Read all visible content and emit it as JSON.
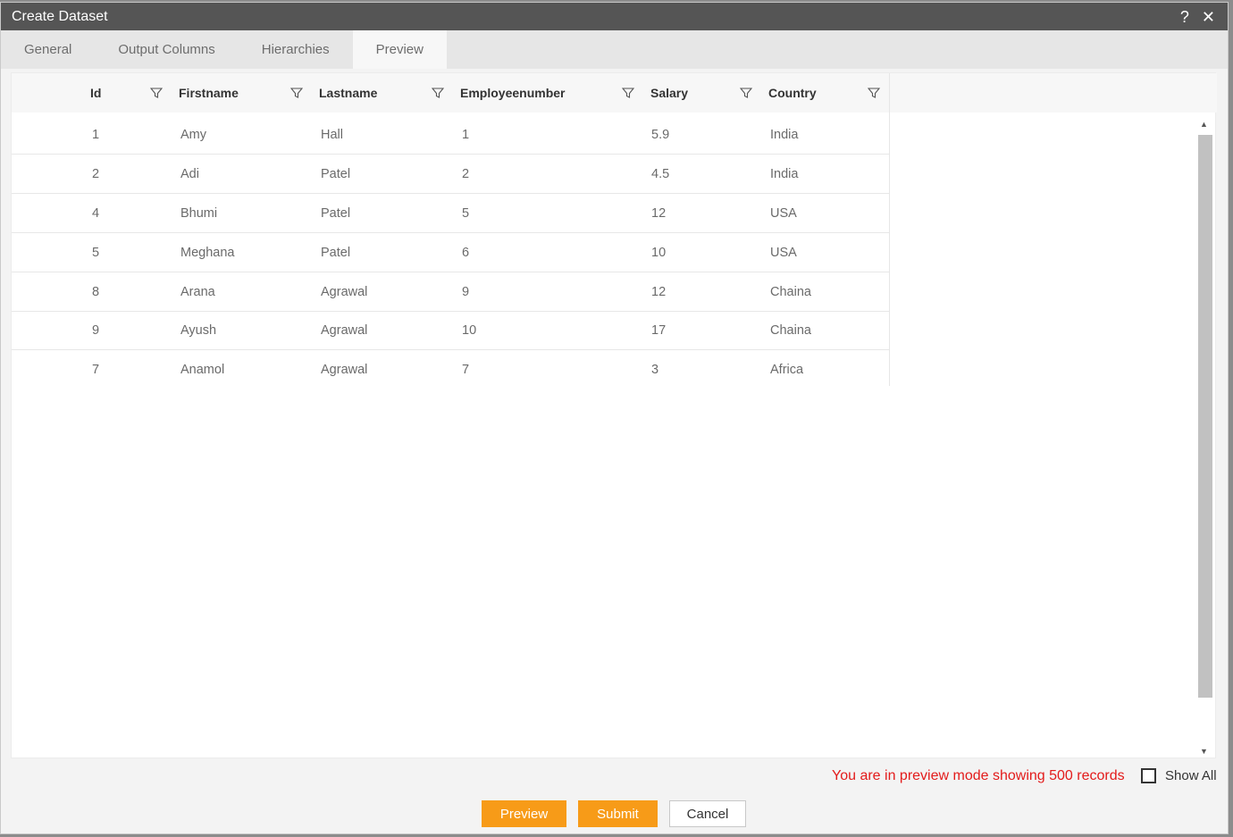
{
  "dialog": {
    "title": "Create Dataset",
    "help_icon": "?",
    "close_icon": "✕"
  },
  "tabs": [
    {
      "label": "General"
    },
    {
      "label": "Output Columns"
    },
    {
      "label": "Hierarchies"
    },
    {
      "label": "Preview",
      "active": true
    }
  ],
  "grid": {
    "columns": [
      "Id",
      "Firstname",
      "Lastname",
      "Employeenumber",
      "Salary",
      "Country"
    ],
    "rows": [
      [
        "1",
        "Amy",
        "Hall",
        "1",
        "5.9",
        "India"
      ],
      [
        "2",
        "Adi",
        "Patel",
        "2",
        "4.5",
        "India"
      ],
      [
        "4",
        "Bhumi",
        "Patel",
        "5",
        "12",
        "USA"
      ],
      [
        "5",
        "Meghana",
        "Patel",
        "6",
        "10",
        "USA"
      ],
      [
        "8",
        "Arana",
        "Agrawal",
        "9",
        "12",
        "Chaina"
      ],
      [
        "9",
        "Ayush",
        "Agrawal",
        "10",
        "17",
        "Chaina"
      ],
      [
        "7",
        "Anamol",
        "Agrawal",
        "7",
        "3",
        "Africa"
      ]
    ]
  },
  "footer": {
    "notice": "You are in preview mode showing 500 records",
    "show_all_label": "Show All",
    "preview_button": "Preview",
    "submit_button": "Submit",
    "cancel_button": "Cancel"
  },
  "colors": {
    "accent": "#f79b18",
    "notice": "#e31b1b",
    "titlebar": "#555555"
  }
}
